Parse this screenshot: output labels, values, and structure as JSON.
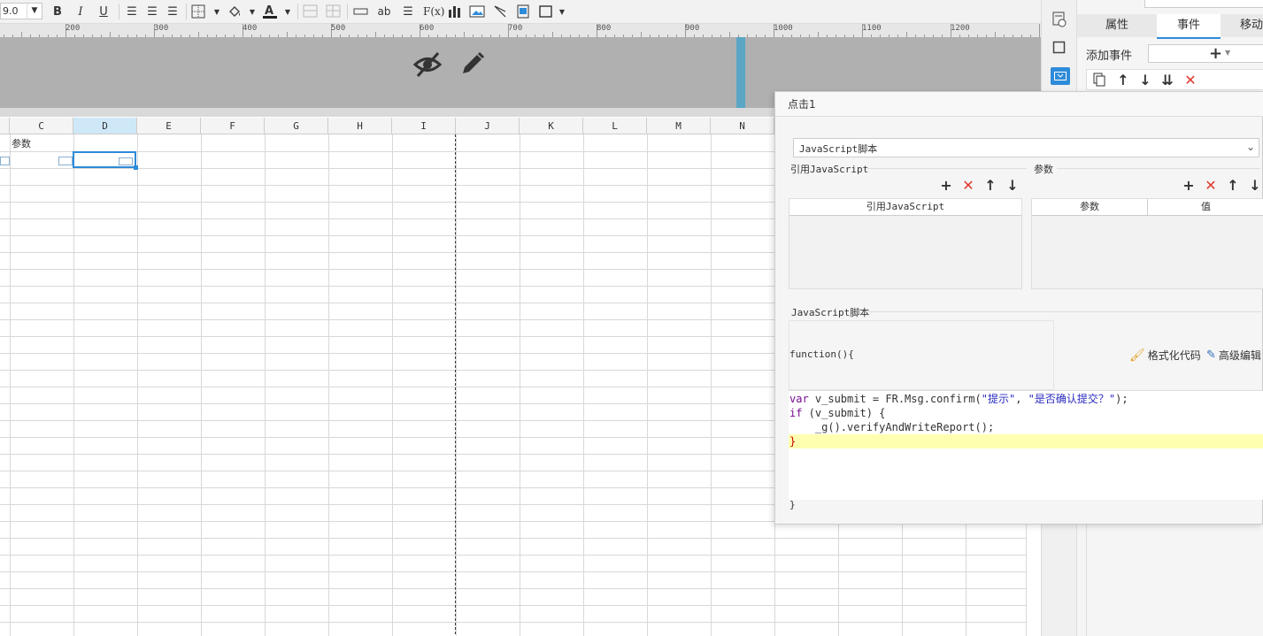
{
  "toolbar": {
    "font_size": "9.0",
    "bold_label": "B",
    "italic_label": "I",
    "underline_label": "U",
    "text_label": "ab",
    "formula_label": "F(x)"
  },
  "ruler": {
    "labels": [
      "200",
      "300",
      "400",
      "500",
      "600",
      "700",
      "800",
      "900",
      "1000",
      "1100",
      "1200"
    ]
  },
  "sheet": {
    "columns": [
      "C",
      "D",
      "E",
      "F",
      "G",
      "H",
      "I",
      "J",
      "K",
      "L",
      "M",
      "N"
    ],
    "selected_column": "D",
    "cell_c1": "参数"
  },
  "right_panel": {
    "tabs": [
      "属性",
      "事件",
      "移动"
    ],
    "active_tab": "事件",
    "add_event_label": "添加事件"
  },
  "dialog": {
    "title": "点击1",
    "type_select": "JavaScript脚本",
    "ref_js_section": "引用JavaScript",
    "params_section": "参数",
    "ref_js_column": "引用JavaScript",
    "param_column": "参数",
    "value_column": "值",
    "script_section": "JavaScript脚本",
    "function_head": "function(){",
    "function_tail": "}",
    "format_code_label": "格式化代码",
    "advanced_edit_label": "高级编辑",
    "code": {
      "l1_kw": "var",
      "l1_a": " v_submit = FR.Msg.confirm(",
      "l1_s1": "\"提示\"",
      "l1_b": ", ",
      "l1_s2": "\"是否确认提交？\"",
      "l1_c": ");",
      "l2_kw": "if",
      "l2_a": " (v_submit) {",
      "l3": "    _g().verifyAndWriteReport();",
      "l4": "}"
    }
  },
  "colors": {
    "accent": "#2e8bd8",
    "delete": "#e03a2f",
    "param_area": "#b0b0b0",
    "highlight_line": "#ffffb0"
  }
}
